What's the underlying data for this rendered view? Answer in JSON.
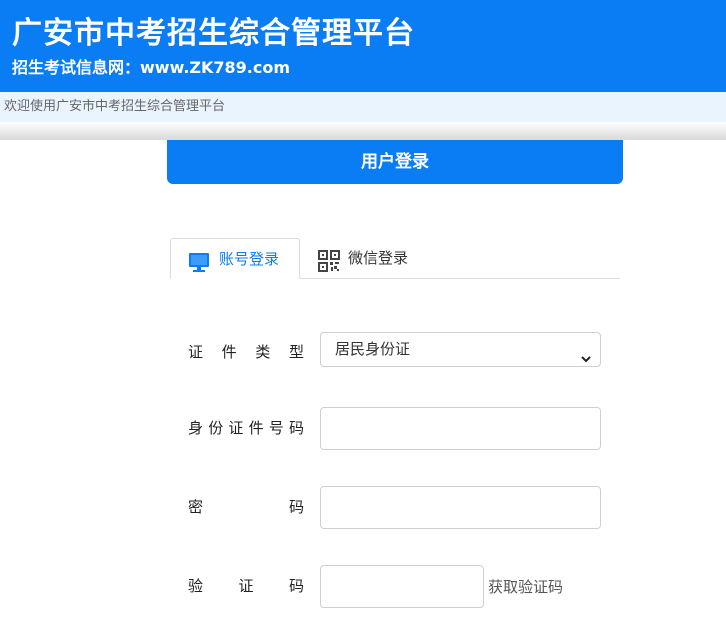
{
  "header": {
    "title": "广安市中考招生综合管理平台",
    "subtitle": "招生考试信息网：www.ZK789.com"
  },
  "welcome_text": "欢迎使用广安市中考招生综合管理平台",
  "login": {
    "heading": "用户登录",
    "tabs": [
      {
        "label": "账号登录",
        "icon": "monitor-icon",
        "active": true
      },
      {
        "label": "微信登录",
        "icon": "qrcode-icon",
        "active": false
      }
    ],
    "fields": {
      "id_type": {
        "label_chars": [
          "证",
          "件",
          "类",
          "型"
        ],
        "value": "居民身份证"
      },
      "id_number": {
        "label_chars": [
          "身",
          "份",
          "证",
          "件",
          "号",
          "码"
        ],
        "value": ""
      },
      "password": {
        "label_chars": [
          "密",
          "码"
        ],
        "value": ""
      },
      "captcha": {
        "label_chars": [
          "验",
          "证",
          "码"
        ],
        "value": ""
      }
    },
    "get_code_label": "获取验证码"
  },
  "colors": {
    "brand_blue": "#0a7cf4",
    "welcome_bg": "#eaf4fe"
  }
}
